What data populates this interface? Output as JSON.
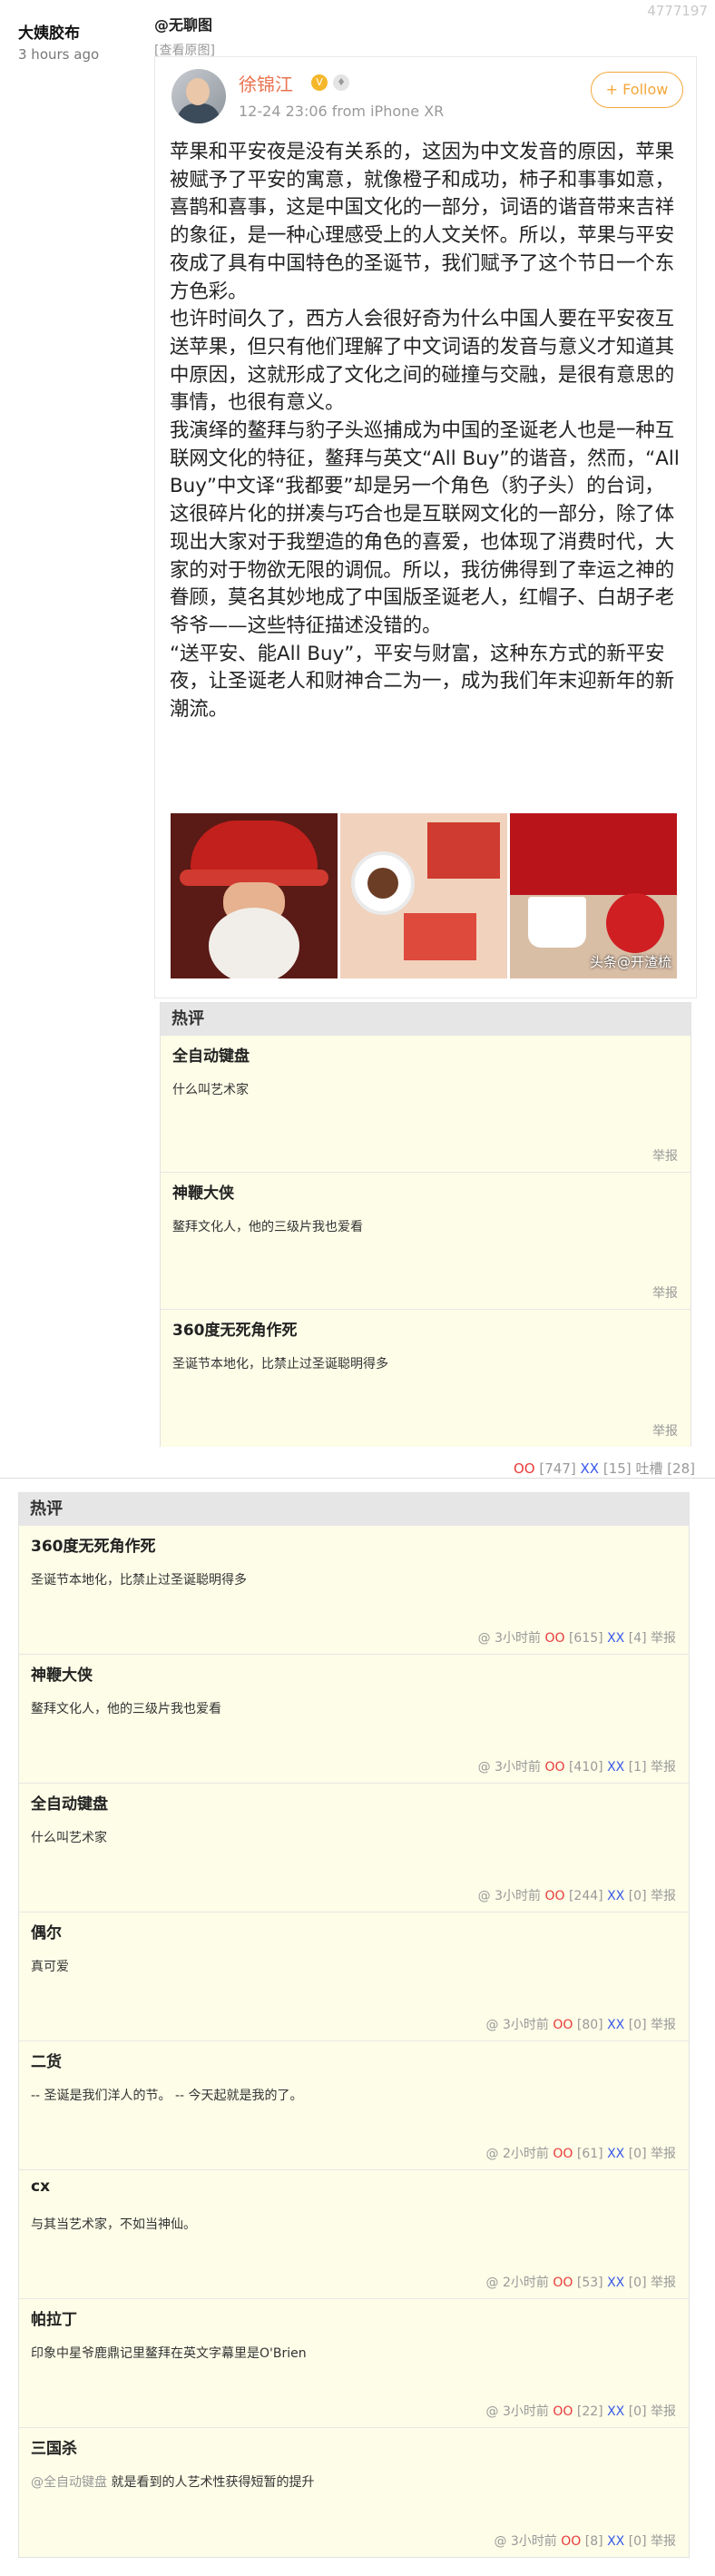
{
  "post": {
    "id": "4777197",
    "author": "大姨胶布",
    "time": "3 hours ago",
    "repost_source": "@无聊图",
    "view_original": "[查看原图]"
  },
  "weibo": {
    "name": "徐锦江",
    "meta": "12-24 23:06  from iPhone XR",
    "follow_label": "+ Follow",
    "paragraphs": [
      "苹果和平安夜是没有关系的，这因为中文发音的原因，苹果被赋予了平安的寓意，就像橙子和成功，柿子和事事如意，喜鹊和喜事，这是中国文化的一部分，词语的谐音带来吉祥的象征，是一种心理感受上的人文关怀。所以，苹果与平安夜成了具有中国特色的圣诞节，我们赋予了这个节日一个东方色彩。",
      "也许时间久了，西方人会很好奇为什么中国人要在平安夜互送苹果，但只有他们理解了中文词语的发音与意义才知道其中原因，这就形成了文化之间的碰撞与交融，是很有意思的事情，也很有意义。",
      "我演绎的鳌拜与豹子头巡捕成为中国的圣诞老人也是一种互联网文化的特征，鳌拜与英文“All Buy”的谐音，然而，“All Buy”中文译“我都要”却是另一个角色（豹子头）的台词，这很碎片化的拼凑与巧合也是互联网文化的一部分，除了体现出大家对于我塑造的角色的喜爱，也体现了消费时代，大家的对于物欲无限的调侃。所以，我彷佛得到了幸运之神的眷顾，莫名其妙地成了中国版圣诞老人，红帽子、白胡子老爷爷——这些特征描述没错的。",
      "“送平安、能All Buy”，平安与财富，这种东方式的新平安夜，让圣诞老人和财神合二为一，成为我们年末迎新年的新潮流。"
    ],
    "watermark": "头条@开渣梳"
  },
  "hot_top": {
    "title": "热评",
    "comments": [
      {
        "name": "全自动键盘",
        "text": "什么叫艺术家",
        "report": "举报"
      },
      {
        "name": "神鞭大侠",
        "text": "鳌拜文化人，他的三级片我也爱看",
        "report": "举报"
      },
      {
        "name": "360度无死角作死",
        "text": "圣诞节本地化，比禁止过圣诞聪明得多",
        "report": "举报"
      }
    ]
  },
  "stats": {
    "oo": "OO",
    "oo_count": "[747]",
    "xx": "XX",
    "xx_count": "[15]",
    "tucao": "吐槽 [28]"
  },
  "hot_bottom": {
    "title": "热评",
    "comments": [
      {
        "name": "360度无死角作死",
        "mention": "",
        "text": "圣诞节本地化，比禁止过圣诞聪明得多",
        "time": "@ 3小时前",
        "oo": "OO",
        "oo_count": "[615]",
        "xx": "XX",
        "xx_count": "[4]",
        "report": "举报"
      },
      {
        "name": "神鞭大侠",
        "mention": "",
        "text": "鳌拜文化人，他的三级片我也爱看",
        "time": "@ 3小时前",
        "oo": "OO",
        "oo_count": "[410]",
        "xx": "XX",
        "xx_count": "[1]",
        "report": "举报"
      },
      {
        "name": "全自动键盘",
        "mention": "",
        "text": "什么叫艺术家",
        "time": "@ 3小时前",
        "oo": "OO",
        "oo_count": "[244]",
        "xx": "XX",
        "xx_count": "[0]",
        "report": "举报"
      },
      {
        "name": "偶尔",
        "mention": "",
        "text": "真可爱",
        "time": "@ 3小时前",
        "oo": "OO",
        "oo_count": "[80]",
        "xx": "XX",
        "xx_count": "[0]",
        "report": "举报"
      },
      {
        "name": "二货",
        "mention": "",
        "text": "-- 圣诞是我们洋人的节。 -- 今天起就是我的了。",
        "time": "@ 2小时前",
        "oo": "OO",
        "oo_count": "[61]",
        "xx": "XX",
        "xx_count": "[0]",
        "report": "举报"
      },
      {
        "name": "cx",
        "mention": "",
        "text": "与其当艺术家，不如当神仙。",
        "time": "@ 2小时前",
        "oo": "OO",
        "oo_count": "[53]",
        "xx": "XX",
        "xx_count": "[0]",
        "report": "举报"
      },
      {
        "name": "帕拉丁",
        "mention": "",
        "text": "印象中星爷鹿鼎记里鳌拜在英文字幕里是O'Brien",
        "time": "@ 3小时前",
        "oo": "OO",
        "oo_count": "[22]",
        "xx": "XX",
        "xx_count": "[0]",
        "report": "举报"
      },
      {
        "name": "三国杀",
        "mention": "@全自动键盘",
        "text": " 就是看到的人艺术性获得短暂的提升",
        "time": "@ 3小时前",
        "oo": "OO",
        "oo_count": "[8]",
        "xx": "XX",
        "xx_count": "[0]",
        "report": "举报"
      }
    ]
  }
}
